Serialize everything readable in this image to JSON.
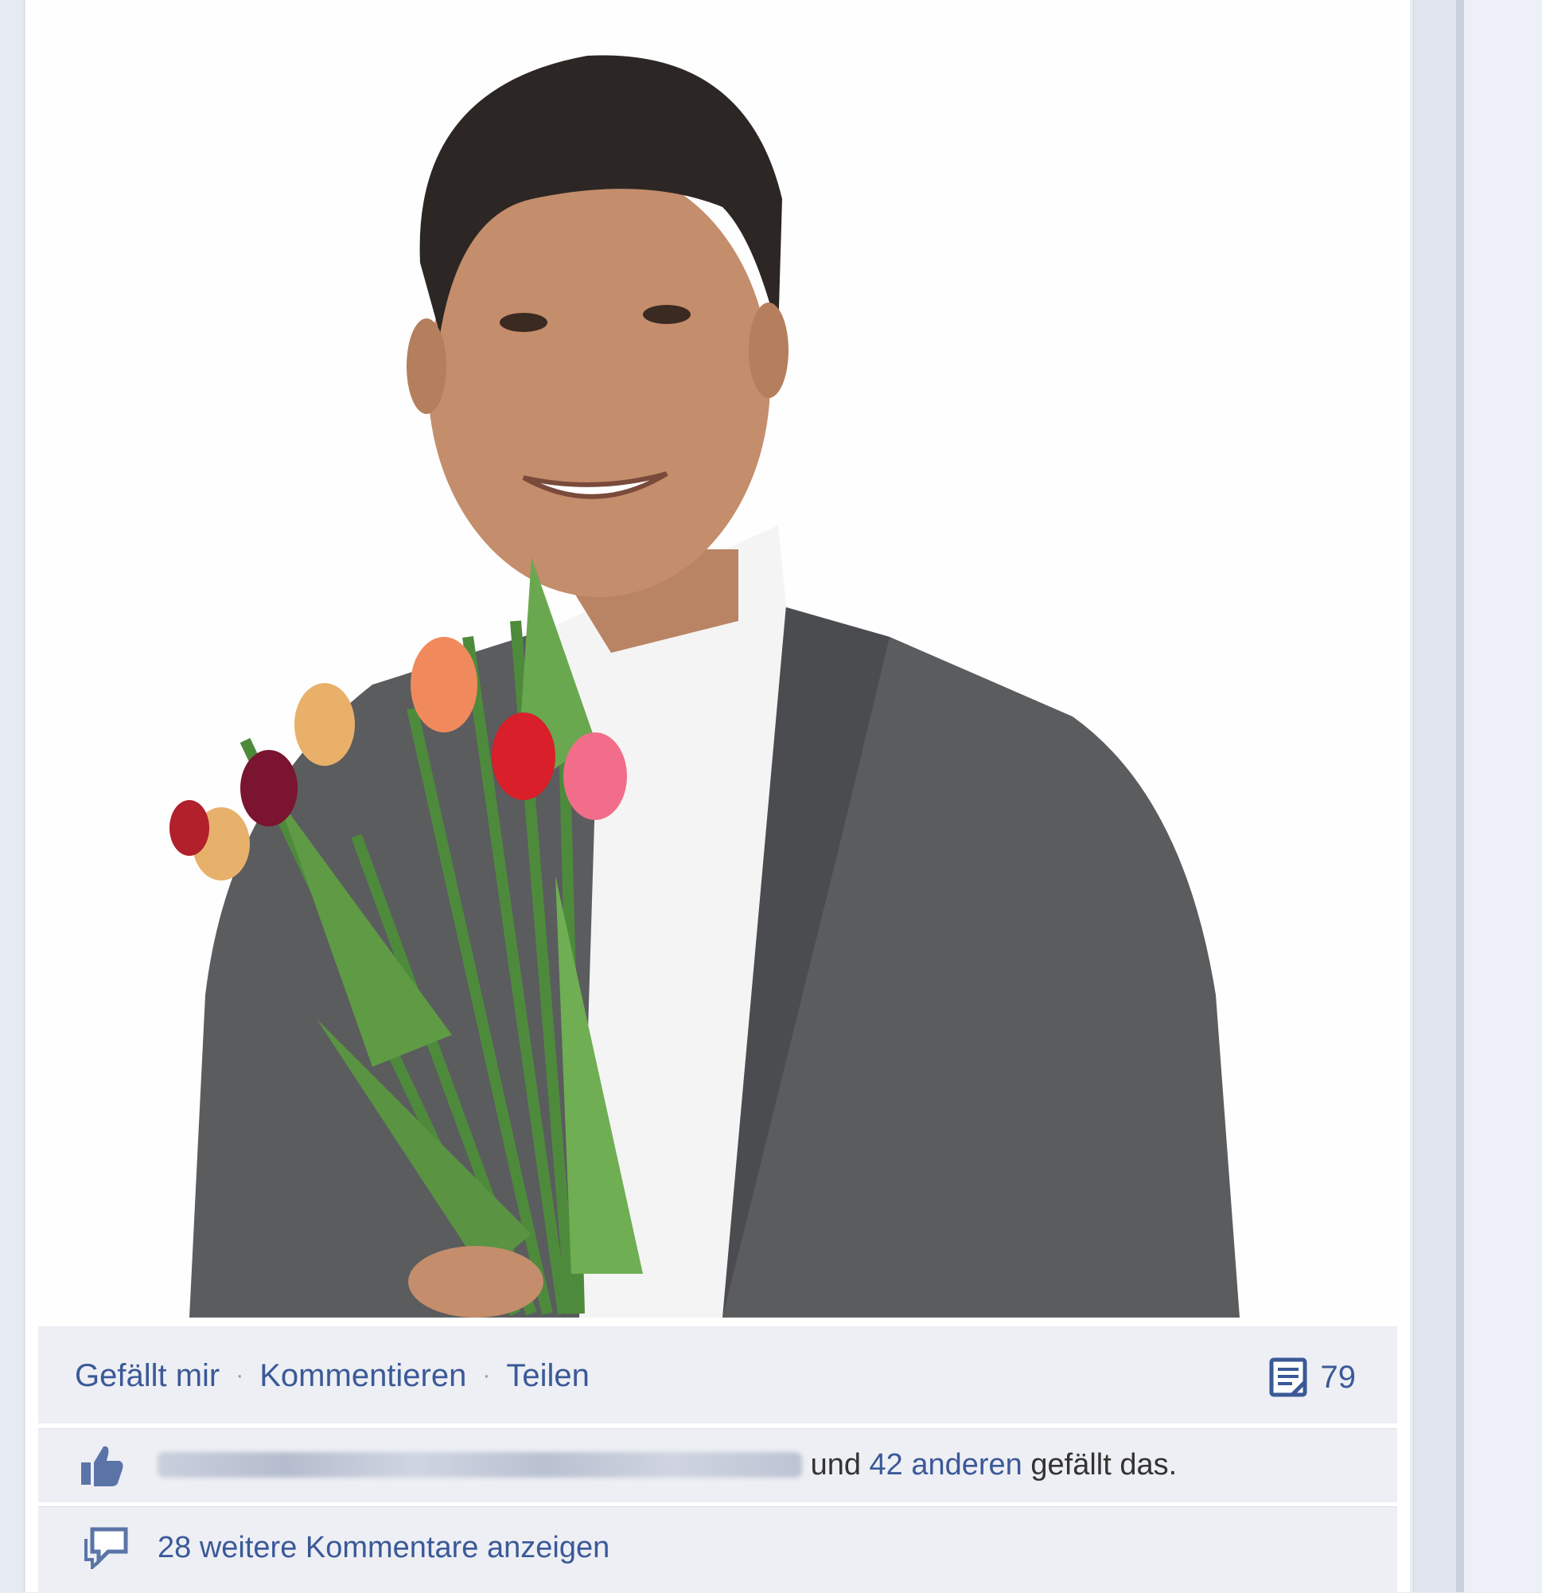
{
  "actions": {
    "like": "Gefällt mir",
    "comment": "Kommentieren",
    "share": "Teilen",
    "comment_count": "79"
  },
  "likes": {
    "connector": "und",
    "others_link": "42 anderen",
    "suffix": "gefällt das."
  },
  "comments": {
    "show_more": "28 weitere Kommentare anzeigen"
  },
  "colors": {
    "link": "#3b5998",
    "bar_background": "#edeff4"
  }
}
